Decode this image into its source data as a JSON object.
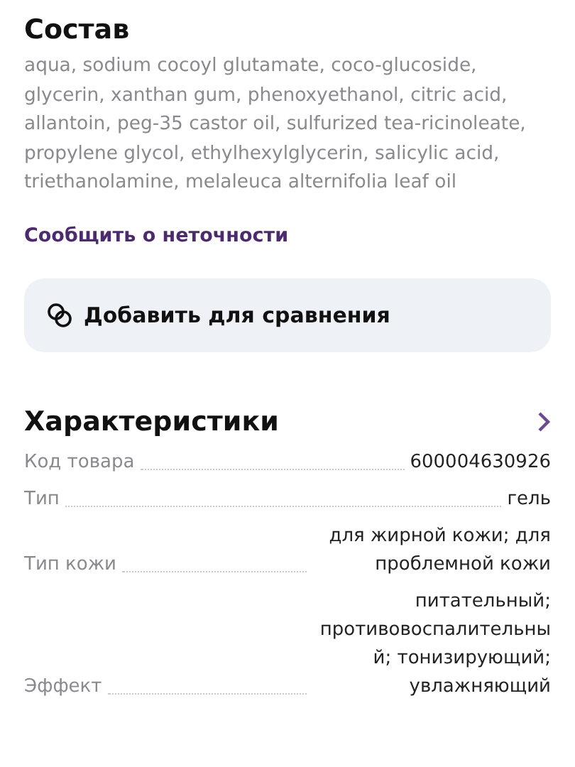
{
  "composition": {
    "title": "Состав",
    "text": "aqua, sodium cocoyl glutamate, coco-glucoside, glycerin, xanthan gum, phenoxyethanol, citric acid, allantoin, peg-35 castor oil, sulfurized tea-ricinoleate, propylene glycol, ethylhexylglycerin, salicylic acid, triethanolamine, melaleuca alternifolia leaf oil",
    "report_link": "Сообщить о неточности"
  },
  "compare_button": {
    "label": "Добавить для сравнения"
  },
  "characteristics": {
    "title": "Характеристики",
    "rows": [
      {
        "label": "Код товара",
        "value": "600004630926"
      },
      {
        "label": "Тип",
        "value": "гель"
      },
      {
        "label": "Тип кожи",
        "value": "для жирной кожи; для проблемной кожи"
      },
      {
        "label": "Эффект",
        "value": "питательный; противовоспалительный; тонизирующий; увлажняющий"
      }
    ]
  }
}
